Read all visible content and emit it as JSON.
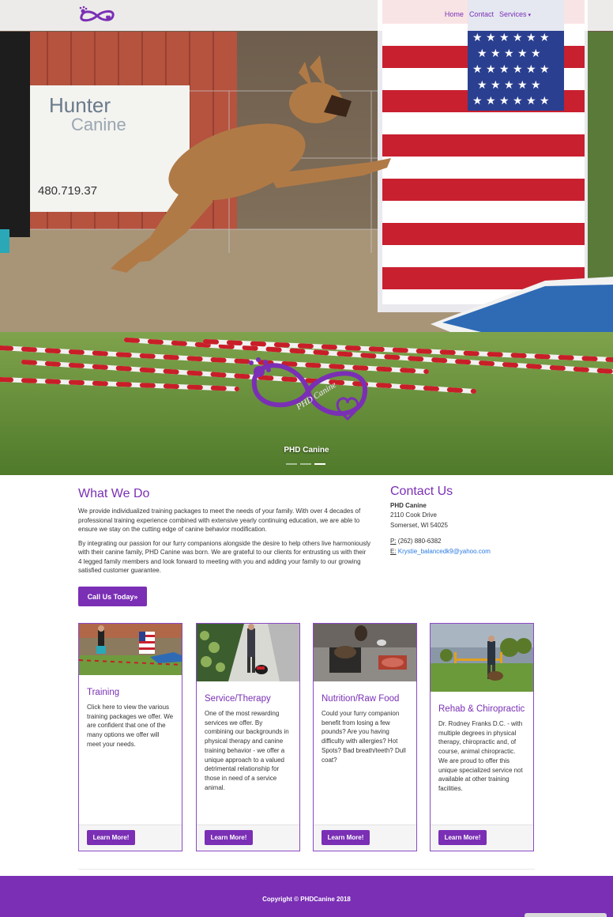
{
  "nav": {
    "logo_icon": "phd-canine-infinity-logo",
    "home": "Home",
    "contact": "Contact",
    "services": "Services",
    "services_caret": "▾"
  },
  "hero": {
    "caption": "PHD Canine",
    "logo_text": "PHD Canine",
    "slides_count": 3,
    "active_slide": 3
  },
  "what_we_do": {
    "title": "What We Do",
    "paragraph_1": "We provide individualized training packages to meet the needs of your family. With over 4 decades of professional training experience combined with extensive yearly continuing education, we are able to ensure we stay on the cutting edge of canine behavior modification.",
    "paragraph_2": "By integrating our passion for our furry companions alongside the desire to help others live harmoniously with their canine family, PHD Canine was born. We are grateful to our clients for entrusting us with their 4 legged family members and look forward to meeting with you and adding your family to our growing satisfied customer guarantee.",
    "cta": "Call Us Today»"
  },
  "contact": {
    "title": "Contact Us",
    "name": "PHD Canine",
    "address_1": "2110 Cook Drive",
    "address_2": "Somerset, WI 54025",
    "phone_label": "P:",
    "phone": "(262) 880-6382",
    "email_label": "E:",
    "email": "Krystie_balancedk9@yahoo.com"
  },
  "cards": [
    {
      "title": "Training",
      "text": "Click here to view the various training packages we offer. We are confident that one of the many options we offer will meet your needs.",
      "button": "Learn More!"
    },
    {
      "title": "Service/Therapy",
      "text": "One of the most rewarding services we offer. By combining our backgrounds in physical therapy and canine training behavior - we offer a unique approach to a valued detrimental relationship for those in need of a service animal.",
      "button": "Learn More!"
    },
    {
      "title": "Nutrition/Raw Food",
      "text": "Could your furry companion benefit from losing a few pounds? Are you having difficulty with allergies? Hot Spots? Bad breath/teeth? Dull coat?",
      "button": "Learn More!"
    },
    {
      "title": "Rehab & Chiropractic",
      "text": "Dr. Rodney Franks D.C. - with multiple degrees in physical therapy, chiropractic and, of course, animal chiropractic. We are proud to offer this unique specialized service not available at other training facilities.",
      "button": "Learn More!"
    }
  ],
  "footer": {
    "copyright": "Copyright © PHDCanine 2018"
  },
  "colors": {
    "brand_purple": "#7a2fb5",
    "link_blue": "#2a7ae2"
  }
}
